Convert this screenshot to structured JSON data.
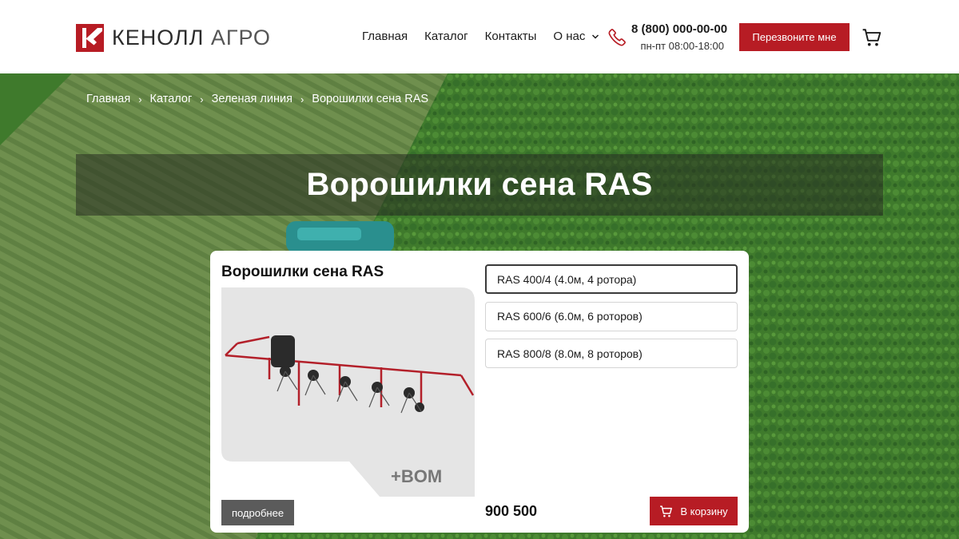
{
  "header": {
    "logo": {
      "word1": "КЕНОЛЛ",
      "word2": "АГРО",
      "brand_color": "#b71c24"
    },
    "nav": [
      {
        "label": "Главная"
      },
      {
        "label": "Каталог"
      },
      {
        "label": "Контакты"
      },
      {
        "label": "О нас",
        "icon": "chevron-down-icon"
      }
    ],
    "phone": {
      "number": "8 (800) 000-00-00",
      "hours": "пн-пт 08:00-18:00",
      "icon": "phone-icon"
    },
    "callback_label": "Перезвоните мне",
    "cart_icon": "cart-icon"
  },
  "breadcrumb": [
    "Главная",
    "Каталог",
    "Зеленая линия",
    "Ворошилки сена RAS"
  ],
  "page_title": "Ворошилки сена RAS",
  "product": {
    "title": "Ворошилки сена RAS",
    "watermark": "+BOM",
    "details_label": "подробнее",
    "options": [
      {
        "label": "RAS 400/4 (4.0м, 4 ротора)",
        "selected": true
      },
      {
        "label": "RAS 600/6 (6.0м, 6 роторов)",
        "selected": false
      },
      {
        "label": "RAS 800/8 (8.0м, 8 роторов)",
        "selected": false
      }
    ],
    "price": "900 500",
    "currency": "",
    "buy_label": "В корзину"
  },
  "colors": {
    "accent": "#b71c24",
    "field_green": "#4f7d37",
    "details_gray": "#5b5b5b"
  }
}
